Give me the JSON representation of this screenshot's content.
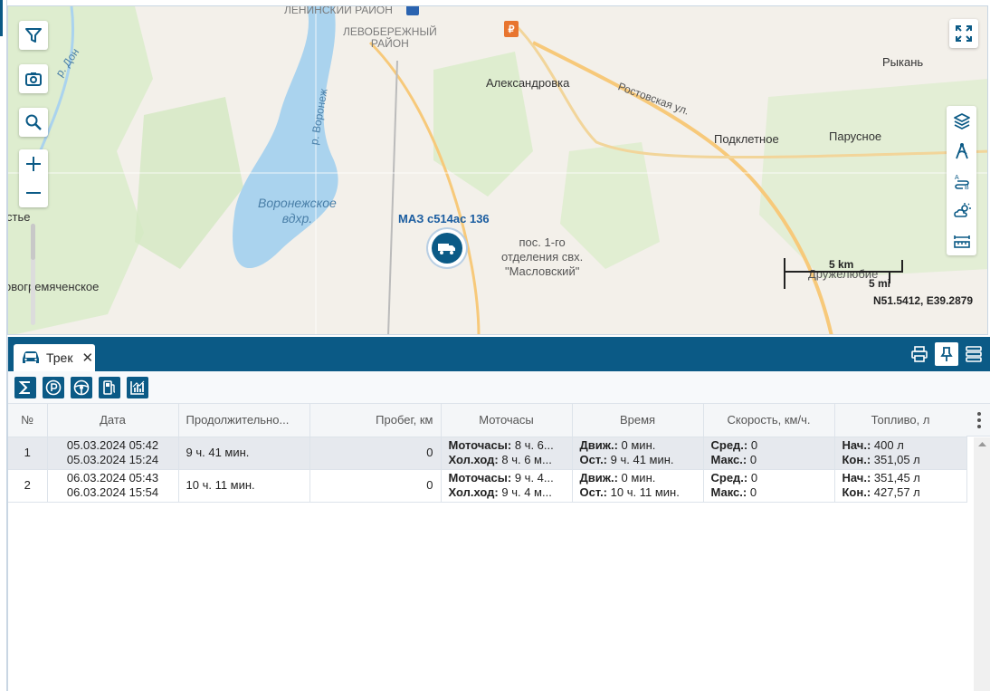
{
  "map": {
    "labels": {
      "district1": "ЛЕНИНСКИЙ\nРАЙОН",
      "district2": "ЛЕВОБЕРЕЖНЫЙ\nРАЙОН",
      "river_don": "р. Дон",
      "river_voronezh": "р. Воронеж",
      "reservoir": "Воронежское\nвдхр.",
      "aleksandrovka": "Александровка",
      "rostovskaya": "Ростовская ул.",
      "podkletnoe": "Подклетное",
      "parusnoe": "Парусное",
      "rykan": "Рыкань",
      "stie": "стье",
      "novogremyachenskoe": "овогремяченское",
      "pos1go": "пос. 1-го\nотделения свх.\n\"Масловский\"",
      "druzhelyubie": "Дружелюбие"
    },
    "vehicle_label": "МАЗ с514ас 136",
    "scale_km": "5 km",
    "scale_mi": "5 mi",
    "coordinates": "N51.5412, E39.2879",
    "icons": {
      "filter": "filter-icon",
      "camera": "camera-icon",
      "search": "search-icon",
      "zoom_in": "plus-icon",
      "zoom_out": "minus-icon",
      "fullscreen": "fullscreen-icon",
      "layers": "layers-icon",
      "route": "route-icon",
      "ab": "a-to-b-icon",
      "weather": "weather-icon",
      "ruler": "ruler-icon"
    },
    "colors": {
      "accent": "#0b5a86",
      "water": "#aad3ee",
      "road": "#f7c97a"
    }
  },
  "panel": {
    "tab_label": "Трек",
    "tab_close": "✕"
  },
  "table": {
    "headers": [
      "№",
      "Дата",
      "Продолжительно...",
      "Пробег, км",
      "Моточасы",
      "Время",
      "Скорость, км/ч.",
      "Топливо, л"
    ],
    "rows": [
      {
        "num": "1",
        "date_start": "05.03.2024 05:42",
        "date_end": "05.03.2024 15:24",
        "duration": "9 ч. 41 мин.",
        "mileage": "0",
        "moto_label": "Моточасы:",
        "moto_val": "8 ч. 6...",
        "idle_label": "Хол.ход:",
        "idle_val": "8 ч. 6 м...",
        "move_label": "Движ.:",
        "move_val": "0 мин.",
        "stop_label": "Ост.:",
        "stop_val": "9 ч. 41 мин.",
        "avg_label": "Сред.:",
        "avg_val": "0",
        "max_label": "Макс.:",
        "max_val": "0",
        "fstart_label": "Нач.:",
        "fstart_val": "400 л",
        "fend_label": "Кон.:",
        "fend_val": "351,05 л"
      },
      {
        "num": "2",
        "date_start": "06.03.2024 05:43",
        "date_end": "06.03.2024 15:54",
        "duration": "10 ч. 11 мин.",
        "mileage": "0",
        "moto_label": "Моточасы:",
        "moto_val": "9 ч. 4...",
        "idle_label": "Хол.ход:",
        "idle_val": "9 ч. 4 м...",
        "move_label": "Движ.:",
        "move_val": "0 мин.",
        "stop_label": "Ост.:",
        "stop_val": "10 ч. 11 мин.",
        "avg_label": "Сред.:",
        "avg_val": "0",
        "max_label": "Макс.:",
        "max_val": "0",
        "fstart_label": "Нач.:",
        "fstart_val": "351,45 л",
        "fend_label": "Кон.:",
        "fend_val": "427,57 л"
      }
    ]
  }
}
